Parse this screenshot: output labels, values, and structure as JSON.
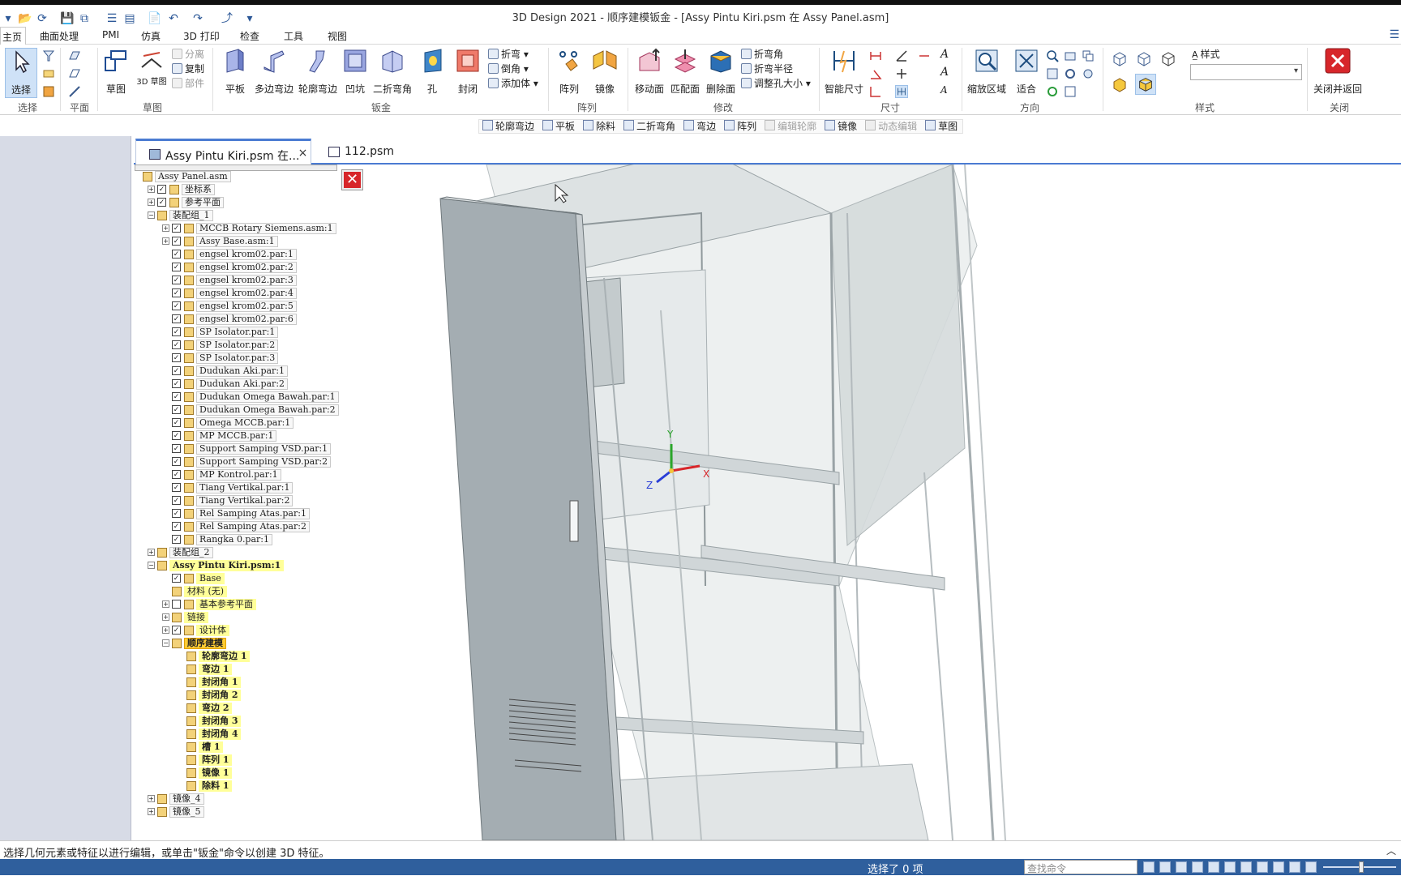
{
  "app": {
    "title": "3D Design 2021 - 顺序建模钣金 - [Assy Pintu Kiri.psm 在 Assy Panel.asm]"
  },
  "menu": {
    "tabs": [
      "主页",
      "曲面处理",
      "PMI",
      "仿真",
      "3D 打印",
      "检查",
      "工具",
      "视图"
    ]
  },
  "ribbon": {
    "groups": {
      "select": "选择",
      "plane": "平面",
      "sketch": "草图",
      "sheetmetal": "钣金",
      "pattern": "阵列",
      "modify": "修改",
      "dimension": "尺寸",
      "orient": "方向",
      "style": "样式",
      "close": "关闭"
    },
    "select_btn": "选择",
    "sketch_btn": "草图",
    "sketch_sub": "3D\n草图",
    "sketch_small": [
      "分离",
      "复制",
      "部件"
    ],
    "tab_btn": "平板",
    "contour_flange": "多边弯边",
    "flange": "轮廓弯边",
    "dimple": "凹坑",
    "close_corner": "二折弯角",
    "hole": "孔",
    "seal": "封闭",
    "sheet_small": [
      "折弯",
      "倒角",
      "添加体"
    ],
    "pattern_btn": "阵列",
    "mirror_btn": "镜像",
    "move_face": "移动面",
    "match_face": "匹配面",
    "delete_face": "删除面",
    "modify_small": [
      "折弯角",
      "折弯半径",
      "调整孔大小"
    ],
    "smart_dim": "智能尺寸",
    "zoom_area": "缩放区域",
    "fit": "适合",
    "style_label": "样式",
    "close_return": "关闭并返回"
  },
  "cmdbar": {
    "items": [
      "轮廓弯边",
      "平板",
      "除料",
      "二折弯角",
      "弯边",
      "阵列",
      "编辑轮廓",
      "镜像",
      "动态编辑",
      "草图"
    ],
    "disabled": [
      false,
      false,
      false,
      false,
      false,
      false,
      true,
      false,
      true,
      false
    ]
  },
  "doc_tabs": [
    {
      "label": "Assy Pintu Kiri.psm 在...",
      "close": "×"
    },
    {
      "label": "112.psm"
    }
  ],
  "tree": {
    "nodes": [
      {
        "label": "Assy Panel.asm",
        "level": 0
      },
      {
        "label": "坐标系",
        "level": 1,
        "exp": "+",
        "chk": true
      },
      {
        "label": "参考平面",
        "level": 1,
        "exp": "+",
        "chk": true
      },
      {
        "label": "装配组_1",
        "level": 1,
        "exp": "−"
      },
      {
        "label": "MCCB Rotary Siemens.asm:1",
        "level": 2,
        "exp": "+",
        "chk": true
      },
      {
        "label": "Assy Base.asm:1",
        "level": 2,
        "exp": "+",
        "chk": true
      },
      {
        "label": "engsel krom02.par:1",
        "level": 2,
        "chk": true
      },
      {
        "label": "engsel krom02.par:2",
        "level": 2,
        "chk": true
      },
      {
        "label": "engsel krom02.par:3",
        "level": 2,
        "chk": true
      },
      {
        "label": "engsel krom02.par:4",
        "level": 2,
        "chk": true
      },
      {
        "label": "engsel krom02.par:5",
        "level": 2,
        "chk": true
      },
      {
        "label": "engsel krom02.par:6",
        "level": 2,
        "chk": true
      },
      {
        "label": "SP Isolator.par:1",
        "level": 2,
        "chk": true
      },
      {
        "label": "SP Isolator.par:2",
        "level": 2,
        "chk": true
      },
      {
        "label": "SP Isolator.par:3",
        "level": 2,
        "chk": true
      },
      {
        "label": "Dudukan Aki.par:1",
        "level": 2,
        "chk": true
      },
      {
        "label": "Dudukan Aki.par:2",
        "level": 2,
        "chk": true
      },
      {
        "label": "Dudukan Omega Bawah.par:1",
        "level": 2,
        "chk": true
      },
      {
        "label": "Dudukan Omega Bawah.par:2",
        "level": 2,
        "chk": true
      },
      {
        "label": "Omega MCCB.par:1",
        "level": 2,
        "chk": true
      },
      {
        "label": "MP MCCB.par:1",
        "level": 2,
        "chk": true
      },
      {
        "label": "Support Samping VSD.par:1",
        "level": 2,
        "chk": true
      },
      {
        "label": "Support Samping VSD.par:2",
        "level": 2,
        "chk": true
      },
      {
        "label": "MP Kontrol.par:1",
        "level": 2,
        "chk": true
      },
      {
        "label": "Tiang Vertikal.par:1",
        "level": 2,
        "chk": true
      },
      {
        "label": "Tiang Vertikal.par:2",
        "level": 2,
        "chk": true
      },
      {
        "label": "Rel Samping Atas.par:1",
        "level": 2,
        "chk": true
      },
      {
        "label": "Rel Samping Atas.par:2",
        "level": 2,
        "chk": true
      },
      {
        "label": "Rangka 0.par:1",
        "level": 2,
        "chk": true
      },
      {
        "label": "装配组_2",
        "level": 1,
        "exp": "+"
      },
      {
        "label": "Assy Pintu Kiri.psm:1",
        "level": 1,
        "exp": "−",
        "hl": "bold"
      },
      {
        "label": "Base",
        "level": 2,
        "chk": true,
        "hl": "plain"
      },
      {
        "label": "材料 (无)",
        "level": 2,
        "hl": "plain"
      },
      {
        "label": "基本参考平面",
        "level": 2,
        "exp": "+",
        "chk": false,
        "hl": "plain"
      },
      {
        "label": "链接",
        "level": 2,
        "exp": "+",
        "hl": "plain"
      },
      {
        "label": "设计体",
        "level": 2,
        "exp": "+",
        "chk": true,
        "hl": "plain"
      },
      {
        "label": "顺序建模",
        "level": 2,
        "exp": "−",
        "hl": "cur"
      },
      {
        "label": "轮廓弯边 1",
        "level": 3,
        "hl": "bold"
      },
      {
        "label": "弯边 1",
        "level": 3,
        "hl": "bold"
      },
      {
        "label": "封闭角 1",
        "level": 3,
        "hl": "bold"
      },
      {
        "label": "封闭角 2",
        "level": 3,
        "hl": "bold"
      },
      {
        "label": "弯边 2",
        "level": 3,
        "hl": "bold"
      },
      {
        "label": "封闭角 3",
        "level": 3,
        "hl": "bold"
      },
      {
        "label": "封闭角 4",
        "level": 3,
        "hl": "bold"
      },
      {
        "label": "槽 1",
        "level": 3,
        "hl": "bold"
      },
      {
        "label": "阵列 1",
        "level": 3,
        "hl": "bold"
      },
      {
        "label": "镜像 1",
        "level": 3,
        "hl": "bold"
      },
      {
        "label": "除料 1",
        "level": 3,
        "hl": "bold"
      },
      {
        "label": "镜像_4",
        "level": 1,
        "exp": "+"
      },
      {
        "label": "镜像_5",
        "level": 1,
        "exp": "+"
      }
    ]
  },
  "axes": {
    "x": "X",
    "y": "Y",
    "z": "Z"
  },
  "status": {
    "prompt": "选择几何元素或特征以进行编辑，或单击\"钣金\"命令以创建 3D 特征。",
    "selected": "选择了 0 项",
    "search_placeholder": "查找命令"
  },
  "colors": {
    "accent": "#4a7bd2",
    "highlight": "#ffff99",
    "current": "#ffcc33",
    "bottombar": "#2f5f9d",
    "close_red": "#d7262a"
  }
}
